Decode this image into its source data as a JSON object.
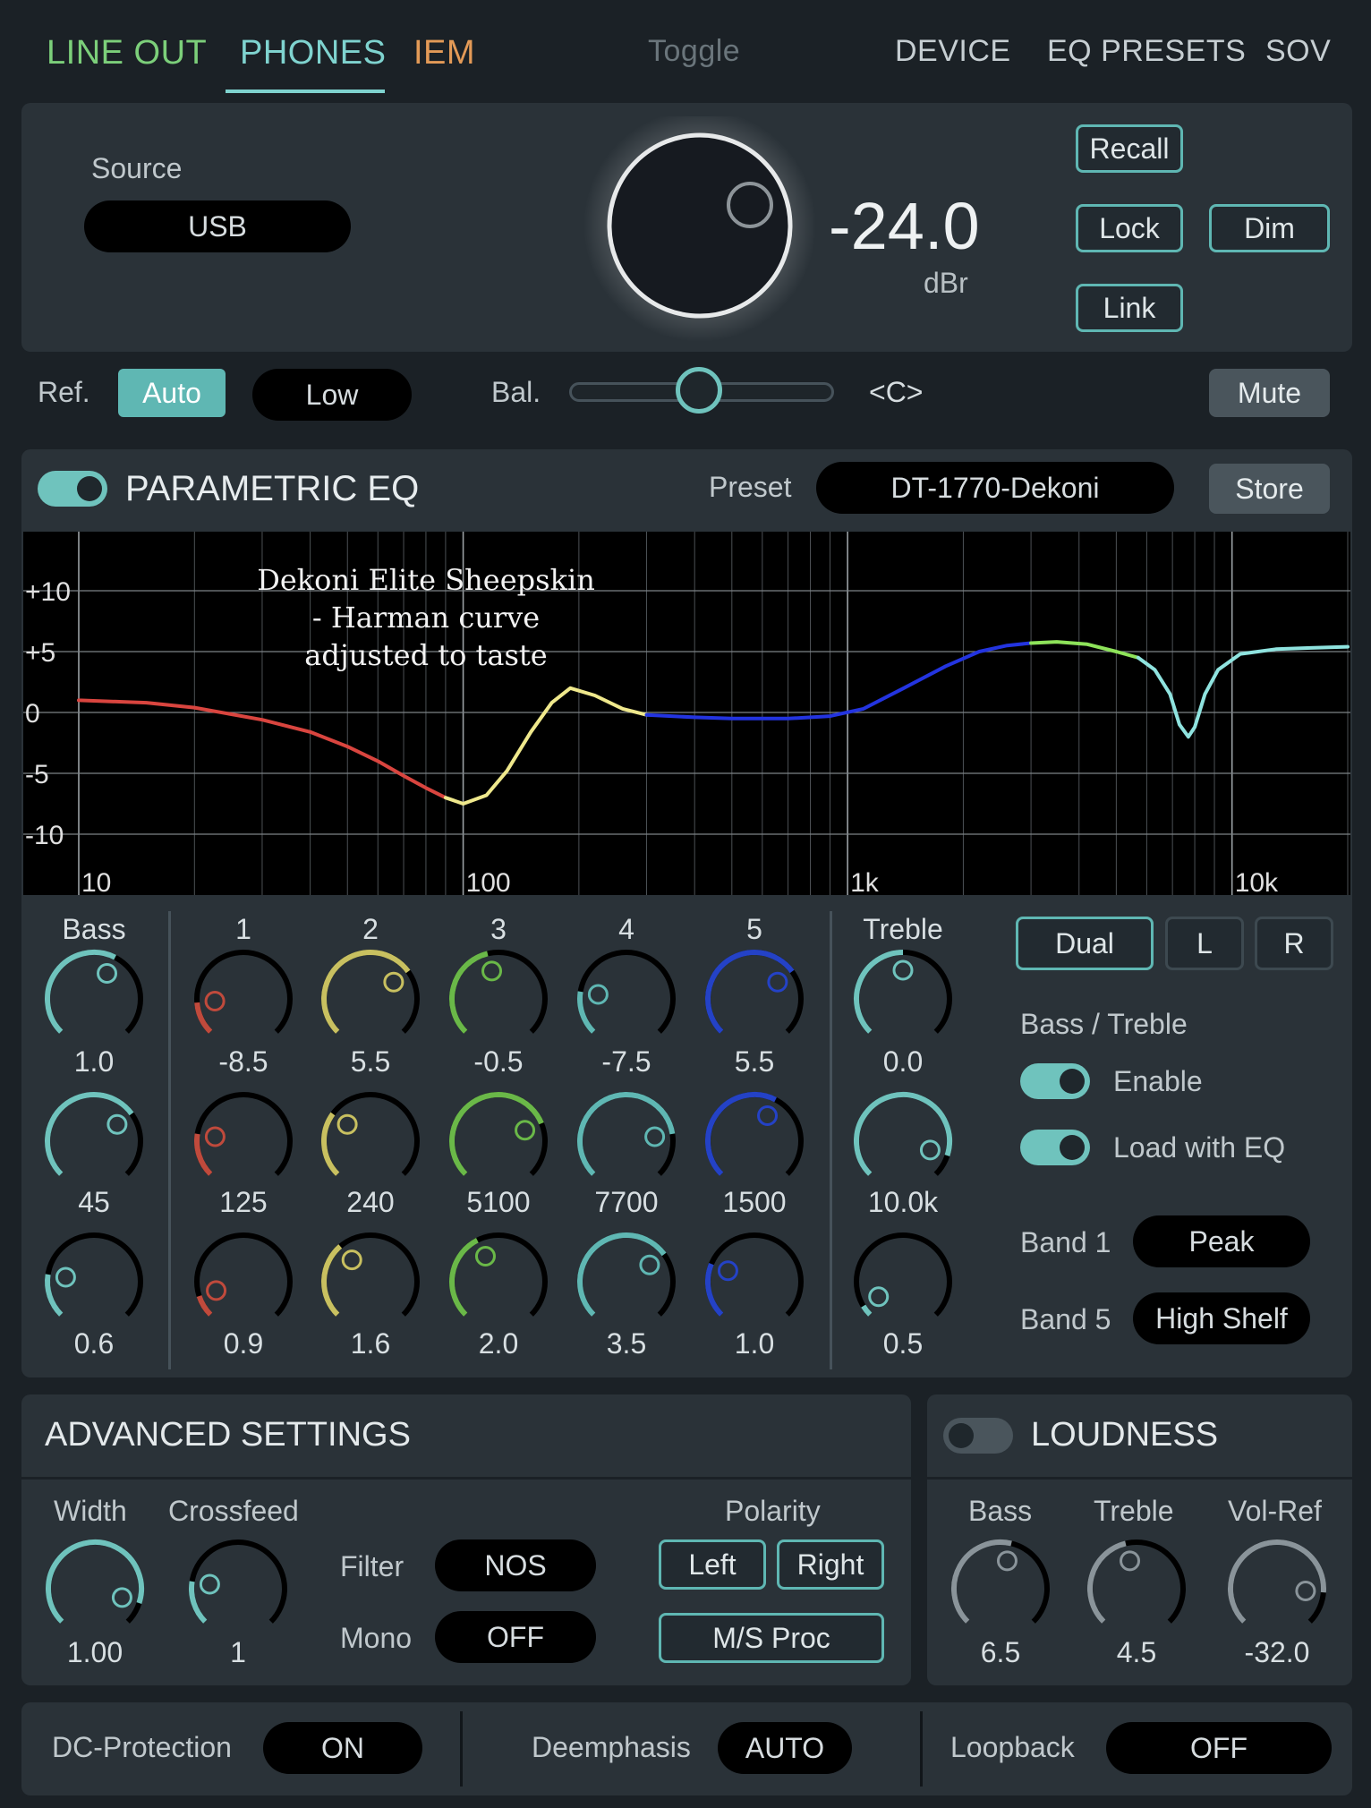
{
  "tabs": [
    {
      "label": "LINE OUT",
      "color": "#7ccf7a"
    },
    {
      "label": "PHONES",
      "color": "#7fd3cf",
      "active": true
    },
    {
      "label": "IEM",
      "color": "#e39a57"
    }
  ],
  "toggle_label": "Toggle",
  "menu": [
    "DEVICE",
    "EQ PRESETS",
    "SOV"
  ],
  "source": {
    "label": "Source",
    "value": "USB"
  },
  "volume": {
    "value": "-24.0",
    "unit": "dBr"
  },
  "vol_buttons": {
    "recall": "Recall",
    "lock": "Lock",
    "dim": "Dim",
    "link": "Link"
  },
  "ref": {
    "label": "Ref.",
    "auto": "Auto",
    "low": "Low"
  },
  "balance": {
    "label": "Bal.",
    "value": "<C>",
    "fraction": 0.5
  },
  "mute": "Mute",
  "peq": {
    "title": "PARAMETRIC EQ",
    "enabled": true,
    "preset_label": "Preset",
    "preset_value": "DT-1770-Dekoni",
    "store": "Store"
  },
  "chart_data": {
    "type": "line",
    "annotation": "Dekoni Elite Sheepskin - Harman curve adjusted to taste",
    "x_ticks": [
      "10",
      "100",
      "1k",
      "10k"
    ],
    "y_ticks": [
      "+10",
      "+5",
      "0",
      "-5",
      "-10"
    ],
    "xlim": [
      10,
      20000
    ],
    "ylim": [
      -15,
      15
    ],
    "x_scale": "log",
    "grid": true,
    "series": [
      {
        "color": "#d9453f",
        "x": [
          10,
          15,
          20,
          30,
          40,
          50,
          60,
          70,
          80,
          90
        ],
        "y": [
          1,
          0.8,
          0.4,
          -0.6,
          -1.6,
          -2.8,
          -4.0,
          -5.2,
          -6.2,
          -7.0
        ]
      },
      {
        "color": "#efe88c",
        "x": [
          90,
          100,
          115,
          130,
          150,
          170,
          190,
          220,
          260,
          300
        ],
        "y": [
          -7.0,
          -7.5,
          -6.8,
          -4.8,
          -1.6,
          0.8,
          2.0,
          1.4,
          0.3,
          -0.2
        ]
      },
      {
        "color": "#2334e0",
        "x": [
          300,
          400,
          500,
          700,
          900,
          1100,
          1400,
          1800,
          2200,
          2600,
          3000
        ],
        "y": [
          -0.2,
          -0.4,
          -0.5,
          -0.5,
          -0.3,
          0.3,
          2.0,
          3.8,
          5.0,
          5.5,
          5.7
        ]
      },
      {
        "color": "#8ee35a",
        "x": [
          3000,
          3500,
          4200,
          5000,
          5700
        ],
        "y": [
          5.7,
          5.8,
          5.6,
          5.0,
          4.5
        ]
      },
      {
        "color": "#8fe3df",
        "x": [
          5700,
          6300,
          6900,
          7300,
          7700,
          8000,
          8500,
          9200,
          10500,
          13000,
          16000,
          20000
        ],
        "y": [
          4.5,
          3.5,
          1.5,
          -1.0,
          -2.0,
          -1.2,
          1.5,
          3.5,
          4.8,
          5.2,
          5.3,
          5.4
        ]
      }
    ]
  },
  "bands": {
    "headers": [
      "Bass",
      "1",
      "2",
      "3",
      "4",
      "5",
      "Treble"
    ],
    "columns": [
      {
        "color": "#6fc3bd",
        "values": [
          "1.0",
          "45",
          "0.6"
        ],
        "levels": [
          0.6,
          0.7,
          0.2
        ]
      },
      {
        "color": "#c04a3c",
        "values": [
          "-8.5",
          "125",
          "0.9"
        ],
        "levels": [
          0.15,
          0.2,
          0.1
        ]
      },
      {
        "color": "#c8c060",
        "values": [
          "5.5",
          "240",
          "1.6"
        ],
        "levels": [
          0.7,
          0.3,
          0.35
        ]
      },
      {
        "color": "#6ab848",
        "values": [
          "-0.5",
          "5100",
          "2.0"
        ],
        "levels": [
          0.45,
          0.75,
          0.4
        ]
      },
      {
        "color": "#5fb7b3",
        "values": [
          "-7.5",
          "7700",
          "3.5"
        ],
        "levels": [
          0.2,
          0.8,
          0.7
        ]
      },
      {
        "color": "#2442c6",
        "values": [
          "5.5",
          "1500",
          "1.0"
        ],
        "levels": [
          0.7,
          0.6,
          0.25
        ]
      },
      {
        "color": "#6fc3bd",
        "values": [
          "0.0",
          "10.0k",
          "0.5"
        ],
        "levels": [
          0.5,
          0.9,
          0.05
        ]
      }
    ]
  },
  "channel": {
    "dual": "Dual",
    "l": "L",
    "r": "R"
  },
  "bass_treble": {
    "title": "Bass / Treble",
    "enable": "Enable",
    "load_with_eq": "Load with EQ",
    "band1_label": "Band 1",
    "band1_value": "Peak",
    "band5_label": "Band 5",
    "band5_value": "High Shelf"
  },
  "advanced": {
    "title": "ADVANCED SETTINGS",
    "width_label": "Width",
    "width_value": "1.00",
    "crossfeed_label": "Crossfeed",
    "crossfeed_value": "1",
    "filter_label": "Filter",
    "filter_value": "NOS",
    "mono_label": "Mono",
    "mono_value": "OFF",
    "polarity_label": "Polarity",
    "left": "Left",
    "right": "Right",
    "ms_proc": "M/S Proc"
  },
  "loudness": {
    "title": "LOUDNESS",
    "enabled": false,
    "bass_label": "Bass",
    "bass_value": "6.5",
    "treble_label": "Treble",
    "treble_value": "4.5",
    "volref_label": "Vol-Ref",
    "volref_value": "-32.0"
  },
  "footer": {
    "dc_label": "DC-Protection",
    "dc_value": "ON",
    "deemph_label": "Deemphasis",
    "deemph_value": "AUTO",
    "loopback_label": "Loopback",
    "loopback_value": "OFF"
  }
}
